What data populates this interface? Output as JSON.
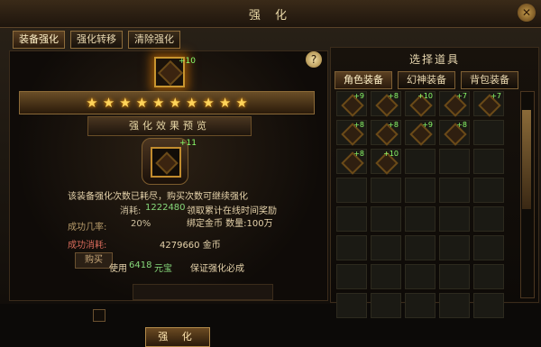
{
  "window": {
    "title": "强 化"
  },
  "tabs": [
    {
      "label": "装备强化"
    },
    {
      "label": "强化转移"
    },
    {
      "label": "清除强化"
    }
  ],
  "left_panel": {
    "top_item_level": "+10",
    "stars": 10,
    "preview_label": "强化效果预览",
    "preview_item_level": "+11",
    "notice": "该装备强化次数已耗尽，购买次数可继续强化",
    "buy_button": "购买",
    "cost_label": "消耗:",
    "cost_value": "1222480",
    "reward_line1": "领取累计在线时间奖励",
    "reward_line2": "绑定金币  数量:100万",
    "success_rate_label": "成功几率:",
    "success_rate_value": "20%",
    "success_cost_label": "成功消耗:",
    "success_cost_value": "4279660 金币",
    "use_label": "使用",
    "use_amount": "6418",
    "use_currency": "元宝",
    "guarantee_text": "保证强化必成",
    "strengthen_button": "强 化"
  },
  "right_panel": {
    "title": "选择道具",
    "tabs": [
      {
        "label": "角色装备"
      },
      {
        "label": "幻神装备"
      },
      {
        "label": "背包装备"
      }
    ],
    "grid_levels": [
      "+9",
      "+8",
      "+10",
      "+7",
      "+7",
      "+8",
      "+8",
      "+9",
      "+8",
      "",
      "+8",
      "+10",
      "",
      "",
      "",
      "",
      "",
      "",
      "",
      "",
      "",
      "",
      "",
      "",
      "",
      "",
      "",
      "",
      "",
      "",
      "",
      "",
      "",
      "",
      "",
      "",
      "",
      "",
      "",
      ""
    ]
  },
  "colors": {
    "gold_text": "#e9d8b0",
    "green_text": "#86d87a",
    "red_text": "#d66a5a",
    "star": "#ffd45a"
  },
  "icons": {
    "close": "close-icon",
    "help": "help-icon",
    "star": "star-icon"
  }
}
